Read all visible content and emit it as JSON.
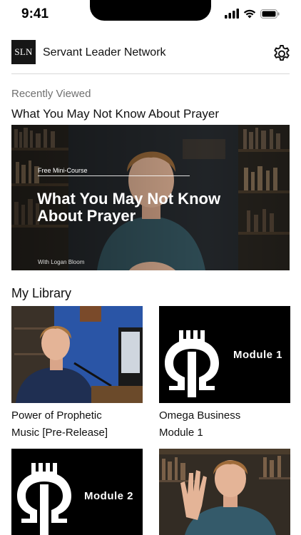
{
  "status_bar": {
    "time": "9:41"
  },
  "header": {
    "logo_text": "SLN",
    "title": "Servant Leader Network",
    "settings_icon": "gear-icon"
  },
  "recently_viewed": {
    "caption": "Recently Viewed",
    "title": "What You May Not Know About Prayer",
    "card": {
      "kicker": "Free Mini-Course",
      "headline": "What You May Not Know About Prayer",
      "byline": "With Logan Bloom"
    }
  },
  "library": {
    "heading": "My Library",
    "items": [
      {
        "caption_line1": "Power of Prophetic",
        "caption_line2": "Music [Pre-Release]"
      },
      {
        "caption_line1": "Omega Business",
        "caption_line2": "Module 1",
        "thumb_label": "Module 1"
      },
      {
        "thumb_label": "Module 2"
      },
      {}
    ]
  },
  "colors": {
    "background": "#ffffff",
    "logo_bg": "#161616",
    "divider": "#d8d8d8",
    "caption_grey": "#707070"
  }
}
